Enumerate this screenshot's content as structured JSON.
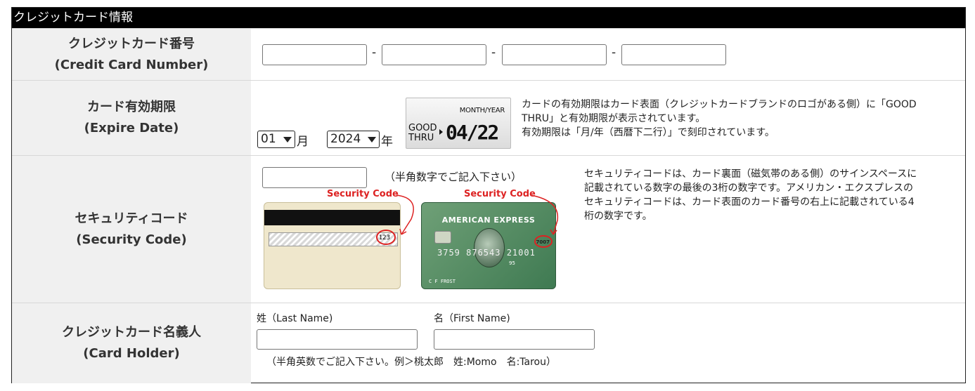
{
  "section": {
    "title": "クレジットカード情報"
  },
  "card_number": {
    "label_ja": "クレジットカード番号",
    "label_en": "(Credit Card Number)",
    "fields": [
      "",
      "",
      "",
      ""
    ],
    "separator": "-"
  },
  "expire": {
    "label_ja": "カード有効期限",
    "label_en": "(Expire Date)",
    "month": {
      "value": "01",
      "unit": "月"
    },
    "year": {
      "value": "2024",
      "unit": "年"
    },
    "card_image": {
      "month_year": "MONTH/YEAR",
      "good": "GOOD",
      "thru": "THRU",
      "date": "04/22"
    },
    "note_1": "カードの有効期限はカード表面（クレジットカードブランドのロゴがある側）に「GOOD",
    "note_2": "THRU」と有効期限が表示されています。",
    "note_3": "有効期限は「月/年（西暦下二行）」で刻印されています。"
  },
  "security": {
    "label_ja": "セキュリティコード",
    "label_en": "(Security Code)",
    "value": "",
    "hint": "（半角数字でご記入下さい）",
    "image_label_back": "Security Code",
    "image_label_front": "Security Code",
    "back_card": {
      "code": "123"
    },
    "front_card": {
      "brand": "AMERICAN EXPRESS",
      "number": "3759 876543 21001",
      "code": "7007",
      "expiry": "95",
      "holder": "C F FROST"
    },
    "note_1": "セキュリティコードは、カード裏面（磁気帯のある側）のサインスペースに",
    "note_2": "記載されている数字の最後の3桁の数字です。アメリカン・エクスプレスの",
    "note_3": "セキュリティコードは、カード表面のカード番号の右上に記載されている4",
    "note_4": "桁の数字です。"
  },
  "holder": {
    "label_ja": "クレジットカード名義人",
    "label_en": "(Card Holder)",
    "last_name_label": "姓（Last Name)",
    "first_name_label": "名（First Name)",
    "last_name": "",
    "first_name": "",
    "hint": "（半角英数でご記入下さい。例＞桃太郎　姓:Momo　名:Tarou）"
  }
}
